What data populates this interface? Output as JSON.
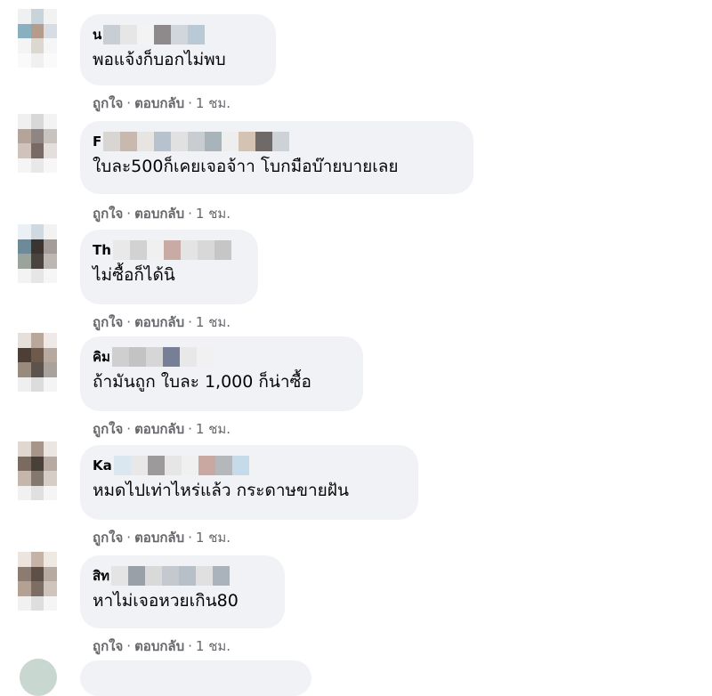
{
  "comments": [
    {
      "author_initial": "น",
      "text": "พอแจ้งก็บอกไม่พบ",
      "like": "ถูกใจ",
      "reply": "ตอบกลับ",
      "time": "1 ชม."
    },
    {
      "author_initial": "F",
      "text": "ใบละ500ก็เคยเจอจ้าา โบกมือบ๊ายบายเลย",
      "like": "ถูกใจ",
      "reply": "ตอบกลับ",
      "time": "1 ชม."
    },
    {
      "author_initial": "Th",
      "text": "ไม่ซื้อก็ได้นิ",
      "like": "ถูกใจ",
      "reply": "ตอบกลับ",
      "time": "1 ชม."
    },
    {
      "author_initial": "คิม",
      "text": "ถ้ามันถูก ใบละ 1,000 ก็น่าซื้อ",
      "like": "ถูกใจ",
      "reply": "ตอบกลับ",
      "time": "1 ชม."
    },
    {
      "author_initial": "Ka",
      "text": "หมดไปเท่าไหร่แล้ว กระดาษขายฝัน",
      "like": "ถูกใจ",
      "reply": "ตอบกลับ",
      "time": "1 ชม."
    },
    {
      "author_initial": "สิท",
      "text": "หาไม่เจอหวยเกิน80",
      "like": "ถูกใจ",
      "reply": "ตอบกลับ",
      "time": "1 ชม."
    }
  ],
  "separator": "·",
  "colors": {
    "bubble": "#f0f2f5",
    "text": "#050505",
    "meta": "#65676b"
  }
}
